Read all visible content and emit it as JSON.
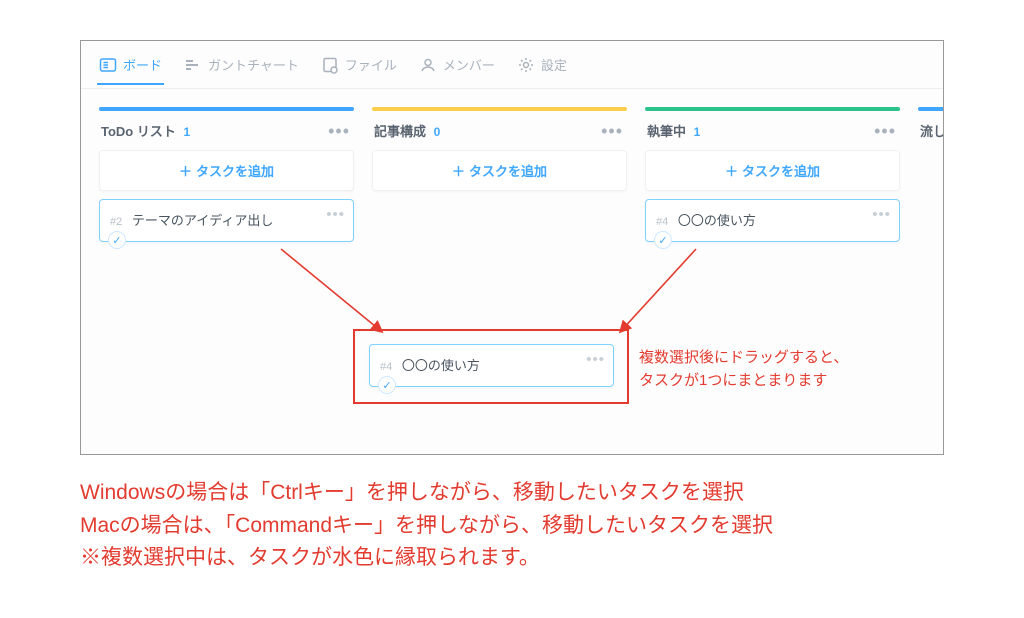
{
  "tabs": {
    "board": "ボード",
    "gantt": "ガントチャート",
    "file": "ファイル",
    "member": "メンバー",
    "settings": "設定"
  },
  "columns": {
    "todo": {
      "title": "ToDo リスト",
      "count": "1",
      "color": "#3fa7ff"
    },
    "struct": {
      "title": "記事構成",
      "count": "0",
      "color": "#ffcf4b"
    },
    "writing": {
      "title": "執筆中",
      "count": "1",
      "color": "#2bc28b"
    },
    "partial": {
      "title": "流し",
      "color": "#3fa7ff"
    }
  },
  "add_task_label": "タスクを追加",
  "cards": {
    "c2": {
      "id": "#2",
      "title": "テーマのアイディア出し"
    },
    "c4a": {
      "id": "#4",
      "title": "〇〇の使い方"
    },
    "c4b": {
      "id": "#4",
      "title": "〇〇の使い方"
    }
  },
  "annot": {
    "drag_line1": "複数選択後にドラッグすると、",
    "drag_line2": "タスクが1つにまとまります"
  },
  "caption": {
    "l1": "Windowsの場合は「Ctrlキー」を押しながら、移動したいタスクを選択",
    "l2": "Macの場合は、「Commandキー」を押しながら、移動したいタスクを選択",
    "l3": "※複数選択中は、タスクが水色に縁取られます。"
  }
}
